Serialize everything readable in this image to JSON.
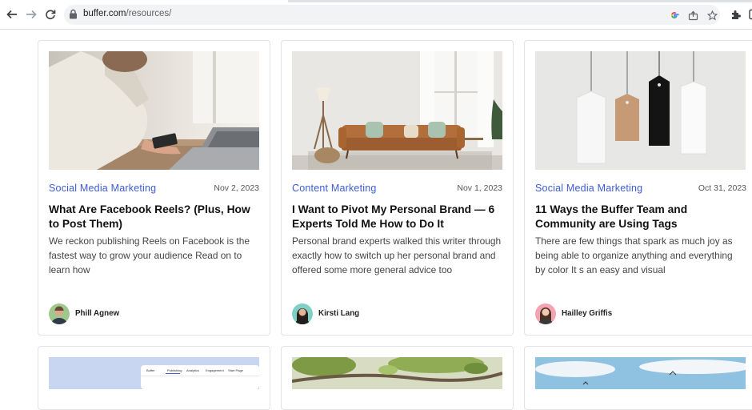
{
  "browser": {
    "url_host": "buffer.com",
    "url_path": "/resources/",
    "icons": [
      "back-arrow-icon",
      "forward-arrow-icon",
      "reload-icon",
      "lock-icon",
      "google-icon",
      "share-icon",
      "star-icon",
      "extensions-icon",
      "side-panel-icon"
    ]
  },
  "colors": {
    "accent": "#3d5cd6",
    "title": "#111111",
    "text": "#444444"
  },
  "cards": [
    {
      "category": "Social Media Marketing",
      "date": "Nov 2, 2023",
      "title": "What Are Facebook Reels? (Plus, How to Post Them)",
      "excerpt": "We reckon publishing Reels on Facebook is the fastest way to grow your audience Read on to learn how",
      "author": "Phill Agnew"
    },
    {
      "category": "Content Marketing",
      "date": "Nov 1, 2023",
      "title": "I Want to Pivot My Personal Brand — 6 Experts Told Me How to Do It",
      "excerpt": "Personal brand experts walked this writer through exactly how to switch up her personal brand and offered some more general advice too",
      "author": "Kirsti Lang"
    },
    {
      "category": "Social Media Marketing",
      "date": "Oct 31, 2023",
      "title": "11 Ways the Buffer Team and Community are Using Tags",
      "excerpt": "There are few things that spark as much joy as being able to organize anything and everything by color It s an easy and visual",
      "author": "Hailley Griffis"
    }
  ],
  "row2_preview": {
    "ui_tabs": [
      "Buffer",
      "Publishing",
      "Analytics",
      "Engagement",
      "Start Page"
    ]
  }
}
